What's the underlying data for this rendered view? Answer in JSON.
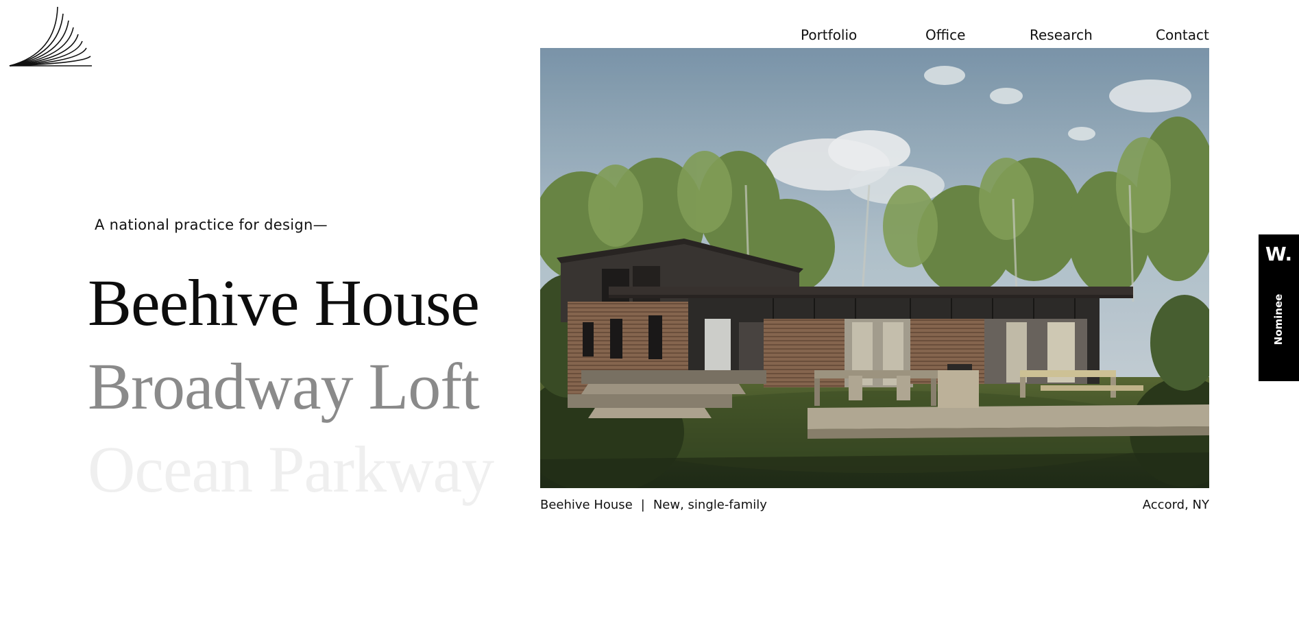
{
  "nav": {
    "items": [
      {
        "label": "Portfolio"
      },
      {
        "label": "Office"
      },
      {
        "label": "Research"
      },
      {
        "label": "Contact"
      }
    ]
  },
  "tagline": "A national practice for design—",
  "projects": [
    {
      "name": "Beehive House",
      "state": "active"
    },
    {
      "name": "Broadway Loft",
      "state": "next"
    },
    {
      "name": "Ocean Parkway",
      "state": "faded"
    }
  ],
  "caption": {
    "project": "Beehive House",
    "separator": "|",
    "type": "New, single-family",
    "location": "Accord, NY"
  },
  "badge": {
    "logo": "W.",
    "label": "Nominee"
  },
  "colors": {
    "background": "#ffffff",
    "text": "#111111",
    "project_active": "#0d0d0d",
    "project_next": "#8a8a8a",
    "project_faded": "#efefef",
    "badge_bg": "#000000"
  },
  "icons": {
    "logo": "fan-lines-logo-icon"
  }
}
